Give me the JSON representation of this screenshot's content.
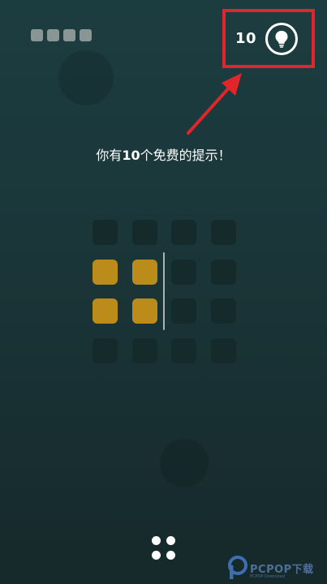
{
  "progress": {
    "total": 4
  },
  "hint": {
    "count": "10",
    "message_pre": "你有",
    "message_num": "10",
    "message_post": "个免费的提示！"
  },
  "grid": {
    "rows": 4,
    "cols": 4,
    "filled": [
      [
        1,
        0
      ],
      [
        1,
        1
      ],
      [
        2,
        0
      ],
      [
        2,
        1
      ]
    ]
  },
  "colors": {
    "highlight": "#e1262b",
    "tile_filled": "#bc8c1a",
    "tile_empty": "#142a2b"
  },
  "watermark": {
    "text": "PCPOP下载",
    "sub": "PCPOP Download"
  }
}
